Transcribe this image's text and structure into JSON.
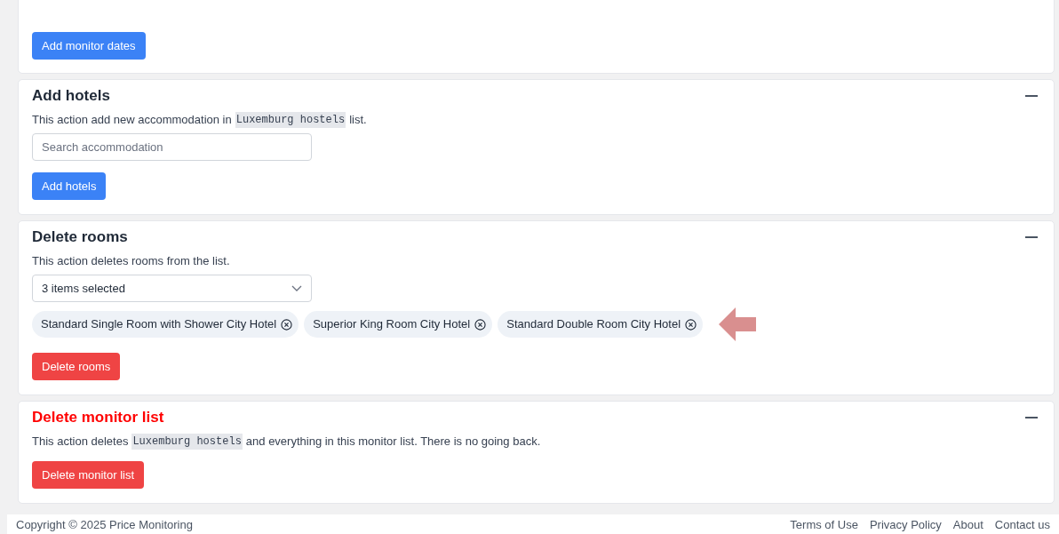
{
  "sections": [
    {
      "kind": "partial",
      "button": {
        "label": "Add monitor dates"
      }
    },
    {
      "kind": "search",
      "title": "Add hotels",
      "danger": false,
      "description": [
        {
          "kind": "text",
          "text": "This action add new accommodation in"
        },
        {
          "kind": "code",
          "text": "Luxemburg hostels"
        },
        {
          "kind": "text",
          "text": "list."
        }
      ],
      "placeholder": "Search accommodation",
      "button": {
        "label": "Add hotels"
      }
    },
    {
      "kind": "multiselect",
      "title": "Delete rooms",
      "danger": false,
      "description": [
        {
          "kind": "text",
          "text": "This action deletes rooms from the list."
        }
      ],
      "select_value": "3 items selected",
      "chips": [
        "Standard Single Room with Shower City Hotel",
        "Superior King Room City Hotel",
        "Standard Double Room City Hotel"
      ],
      "button": {
        "label": "Delete rooms"
      }
    },
    {
      "kind": "plain",
      "title": "Delete monitor list",
      "danger": true,
      "description": [
        {
          "kind": "text",
          "text": "This action deletes"
        },
        {
          "kind": "code",
          "text": "Luxemburg hostels"
        },
        {
          "kind": "text",
          "text": "and everything in this monitor list. There is no going back."
        }
      ],
      "button": {
        "label": "Delete monitor list"
      }
    }
  ],
  "footer": {
    "copyright": "Copyright © 2025 Price Monitoring",
    "links": [
      "Terms of Use",
      "Privacy Policy",
      "About",
      "Contact us"
    ]
  }
}
